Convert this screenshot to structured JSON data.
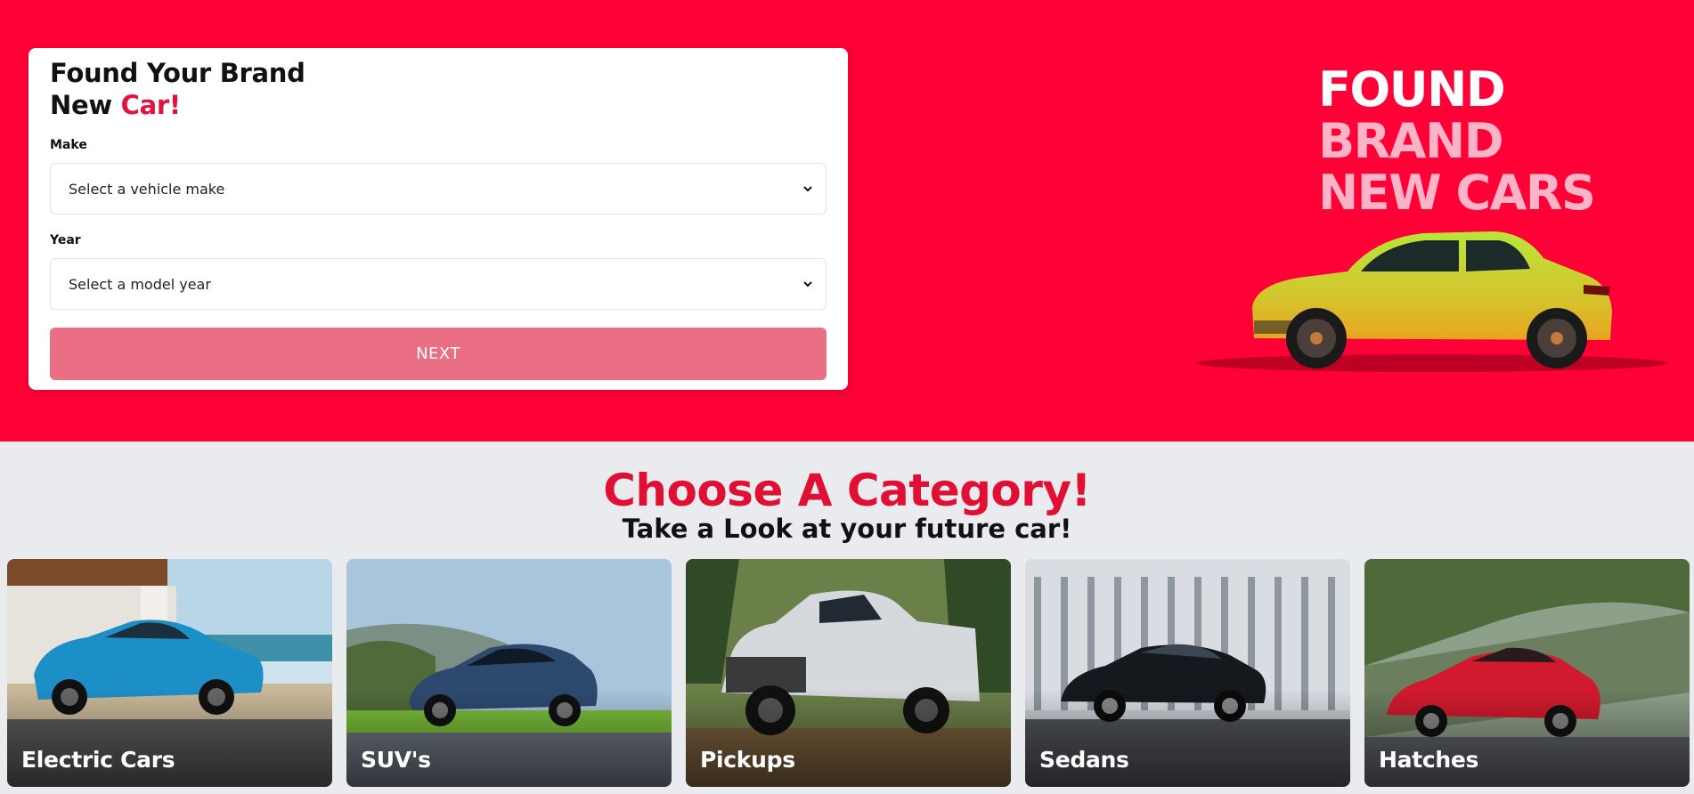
{
  "form": {
    "title_line1": "Found Your Brand",
    "title_line2_plain": "New ",
    "title_line2_accent": "Car!",
    "make_label": "Make",
    "make_placeholder": "Select a vehicle make",
    "year_label": "Year",
    "year_placeholder": "Select a model year",
    "next_label": "NEXT"
  },
  "promo": {
    "line1": "FOUND",
    "line2": "BRAND",
    "line3": "NEW CARS"
  },
  "category": {
    "heading": "Choose A Category!",
    "subheading": "Take a Look at your future car!",
    "cards": [
      {
        "label": "Electric Cars"
      },
      {
        "label": "SUV's"
      },
      {
        "label": "Pickups"
      },
      {
        "label": "Sedans"
      },
      {
        "label": "Hatches"
      }
    ]
  },
  "colors": {
    "hero_bg": "#ff0037",
    "accent": "#e3123f",
    "next_button": "#ea6e84",
    "page_bg": "#e9ebef"
  }
}
